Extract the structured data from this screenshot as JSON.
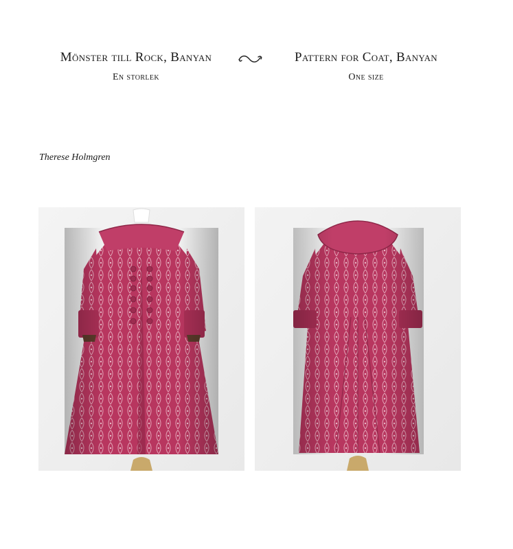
{
  "header": {
    "swedish": {
      "title": "Mönster till Rock, Banyan",
      "subtitle": "En storlek"
    },
    "english": {
      "title": "Pattern for Coat, Banyan",
      "subtitle": "One size"
    },
    "ornament_icon": "swirl-ornament-icon"
  },
  "author": "Therese Holmgren",
  "photos": [
    {
      "view": "front",
      "fabric_color": "#b8365f"
    },
    {
      "view": "back",
      "fabric_color": "#b8365f"
    }
  ]
}
